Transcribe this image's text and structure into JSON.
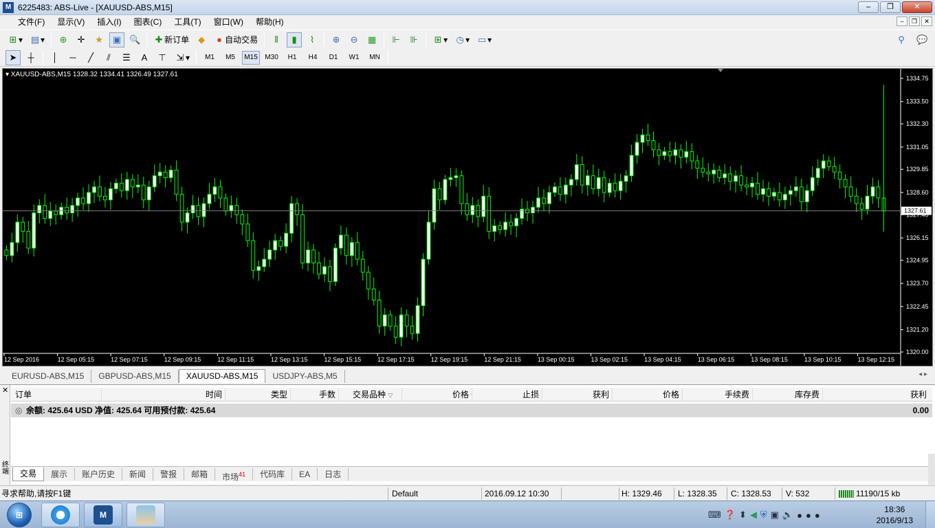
{
  "window": {
    "title": "6225483: ABS-Live - [XAUUSD-ABS,M15]",
    "controls": [
      "‒",
      "❐",
      "✕"
    ]
  },
  "menu": [
    "文件(F)",
    "显示(V)",
    "插入(I)",
    "图表(C)",
    "工具(T)",
    "窗口(W)",
    "帮助(H)"
  ],
  "toolbar": {
    "new_order": "新订单",
    "auto_trading": "自动交易"
  },
  "timeframes": [
    "M1",
    "M5",
    "M15",
    "M30",
    "H1",
    "H4",
    "D1",
    "W1",
    "MN"
  ],
  "active_timeframe": "M15",
  "chart": {
    "header": "XAUUSD-ABS,M15  1328.32 1334.41 1326.49 1327.61",
    "bid_label": "1327.61"
  },
  "chart_data": {
    "type": "candlestick",
    "symbol": "XAUUSD-ABS",
    "timeframe": "M15",
    "ohlc": {
      "open": 1328.32,
      "high": 1334.41,
      "low": 1326.49,
      "close": 1327.61
    },
    "current_price": 1327.61,
    "bid_line": 1327.61,
    "ylim": [
      1320.0,
      1334.75
    ],
    "yticks": [
      "1334.75",
      "1333.50",
      "1332.30",
      "1331.05",
      "1329.85",
      "1328.60",
      "1327.40",
      "1326.15",
      "1324.95",
      "1323.70",
      "1322.45",
      "1321.20",
      "1320.00"
    ],
    "xticks": [
      "12 Sep 2016",
      "12 Sep 05:15",
      "12 Sep 07:15",
      "12 Sep 09:15",
      "12 Sep 11:15",
      "12 Sep 13:15",
      "12 Sep 15:15",
      "12 Sep 17:15",
      "12 Sep 19:15",
      "12 Sep 21:15",
      "13 Sep 00:15",
      "13 Sep 02:15",
      "13 Sep 04:15",
      "13 Sep 06:15",
      "13 Sep 08:15",
      "13 Sep 10:15",
      "13 Sep 12:15"
    ],
    "closes": [
      1325.2,
      1325.9,
      1327.0,
      1326.5,
      1325.6,
      1327.5,
      1327.9,
      1327.2,
      1327.6,
      1327.4,
      1327.8,
      1327.5,
      1327.9,
      1328.3,
      1328.0,
      1328.6,
      1328.9,
      1328.4,
      1328.2,
      1328.8,
      1329.1,
      1328.7,
      1329.3,
      1328.9,
      1329.0,
      1328.2,
      1328.9,
      1329.5,
      1329.7,
      1329.4,
      1329.8,
      1328.5,
      1327.0,
      1327.5,
      1327.9,
      1327.3,
      1328.0,
      1328.5,
      1328.9,
      1328.3,
      1327.6,
      1327.9,
      1327.4,
      1326.9,
      1326.0,
      1324.4,
      1324.6,
      1325.0,
      1325.5,
      1326.0,
      1325.7,
      1326.4,
      1328.0,
      1327.4,
      1324.8,
      1325.5,
      1324.8,
      1324.2,
      1324.6,
      1323.8,
      1325.6,
      1326.3,
      1325.2,
      1325.9,
      1325.0,
      1324.3,
      1323.4,
      1322.8,
      1321.4,
      1322.0,
      1321.4,
      1320.8,
      1322.0,
      1321.4,
      1321.0,
      1322.5,
      1325.0,
      1327.0,
      1328.8,
      1328.2,
      1329.3,
      1329.4,
      1329.5,
      1328.0,
      1327.4,
      1327.9,
      1327.3,
      1328.4,
      1326.5,
      1326.8,
      1326.6,
      1327.0,
      1326.8,
      1327.2,
      1327.7,
      1327.5,
      1327.8,
      1328.3,
      1328.0,
      1328.6,
      1328.9,
      1328.5,
      1329.0,
      1329.3,
      1330.1,
      1329.0,
      1329.5,
      1328.8,
      1329.4,
      1328.6,
      1329.1,
      1328.7,
      1329.2,
      1329.5,
      1330.6,
      1331.3,
      1331.7,
      1331.4,
      1330.9,
      1330.6,
      1330.8,
      1330.6,
      1330.9,
      1330.5,
      1330.8,
      1330.3,
      1329.9,
      1329.7,
      1329.6,
      1329.8,
      1329.4,
      1329.6,
      1329.2,
      1329.5,
      1329.0,
      1328.9,
      1329.1,
      1328.5,
      1328.8,
      1328.4,
      1328.6,
      1328.2,
      1328.5,
      1328.7,
      1328.9,
      1328.1,
      1328.7,
      1329.4,
      1329.9,
      1330.3,
      1330.0,
      1329.7,
      1329.3,
      1328.9,
      1328.4,
      1328.0,
      1327.7,
      1328.4,
      1328.9,
      1328.3,
      1327.6
    ],
    "colors": {
      "background": "#000000",
      "bull": "#ffffff",
      "bear": "#000000",
      "outline": "#00ff00",
      "axis_text": "#ffffff",
      "grid_line": "#808080"
    }
  },
  "chart_tabs": [
    "EURUSD-ABS,M15",
    "GBPUSD-ABS,M15",
    "XAUUSD-ABS,M15",
    "USDJPY-ABS,M5"
  ],
  "active_chart_tab": 2,
  "terminal": {
    "side_label": "终端",
    "columns": [
      "订单",
      "时间",
      "类型",
      "手数",
      "交易品种",
      "价格",
      "止损",
      "获利",
      "价格",
      "手续费",
      "库存费",
      "获利"
    ],
    "summary": "余额: 425.64 USD  净值: 425.64  可用预付款: 425.64",
    "summary_profit": "0.00",
    "tabs": [
      {
        "label": "交易"
      },
      {
        "label": "展示"
      },
      {
        "label": "账户历史"
      },
      {
        "label": "新闻"
      },
      {
        "label": "警报"
      },
      {
        "label": "邮箱"
      },
      {
        "label": "市场",
        "badge": "41"
      },
      {
        "label": "代码库"
      },
      {
        "label": "EA"
      },
      {
        "label": "日志"
      }
    ]
  },
  "status": {
    "help": "寻求帮助,请按F1键",
    "profile": "Default",
    "datetime": "2016.09.12 10:30",
    "high": "H: 1329.46",
    "low": "L: 1328.35",
    "close": "C: 1328.53",
    "volume": "V: 532",
    "traffic": "11190/15 kb"
  },
  "taskbar": {
    "time": "18:36",
    "date": "2016/9/13"
  }
}
